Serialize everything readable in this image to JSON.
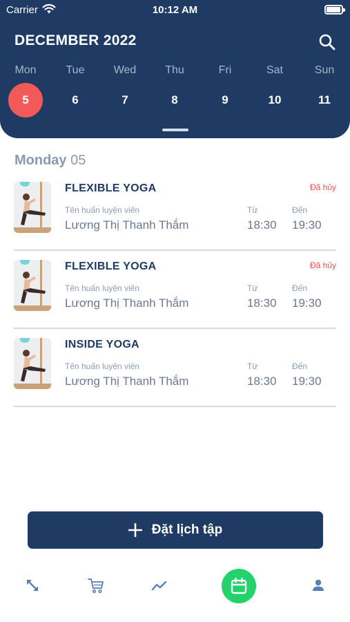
{
  "status_bar": {
    "carrier": "Carrier",
    "time": "10:12 AM"
  },
  "header": {
    "month": "DECEMBER 2022",
    "weekdays": [
      "Mon",
      "Tue",
      "Wed",
      "Thu",
      "Fri",
      "Sat",
      "Sun"
    ],
    "dates": [
      "5",
      "6",
      "7",
      "8",
      "9",
      "10",
      "11"
    ],
    "selected_date": "5"
  },
  "day_label": {
    "weekday": "Monday",
    "day": "05"
  },
  "sessions": [
    {
      "title": "FLEXIBLE YOGA",
      "status": "Đã hủy",
      "trainer_label": "Tên huấn luyện viên",
      "trainer": "Lương Thị Thanh Thắm",
      "from_label": "Từ",
      "from_time": "18:30",
      "to_label": "Đến",
      "to_time": "19:30"
    },
    {
      "title": "FLEXIBLE YOGA",
      "status": "Đã hủy",
      "trainer_label": "Tên huấn luyện viên",
      "trainer": "Lương Thị Thanh Thắm",
      "from_label": "Từ",
      "from_time": "18:30",
      "to_label": "Đến",
      "to_time": "19:30"
    },
    {
      "title": "INSIDE YOGA",
      "status": "",
      "trainer_label": "Tên huấn luyện viên",
      "trainer": "Lương Thị Thanh Thắm",
      "from_label": "Từ",
      "from_time": "18:30",
      "to_label": "Đến",
      "to_time": "19:30"
    }
  ],
  "book_button": {
    "label": "Đặt lịch tập"
  },
  "tab_bar": {
    "tabs": [
      "expand-icon",
      "cart-icon",
      "trend-icon",
      "calendar-icon",
      "user-icon"
    ],
    "active": "calendar-icon"
  },
  "colors": {
    "primary": "#1f3a63",
    "selected_day": "#f25a5a",
    "cancelled": "#e84f4f",
    "active_tab": "#23d26a"
  }
}
